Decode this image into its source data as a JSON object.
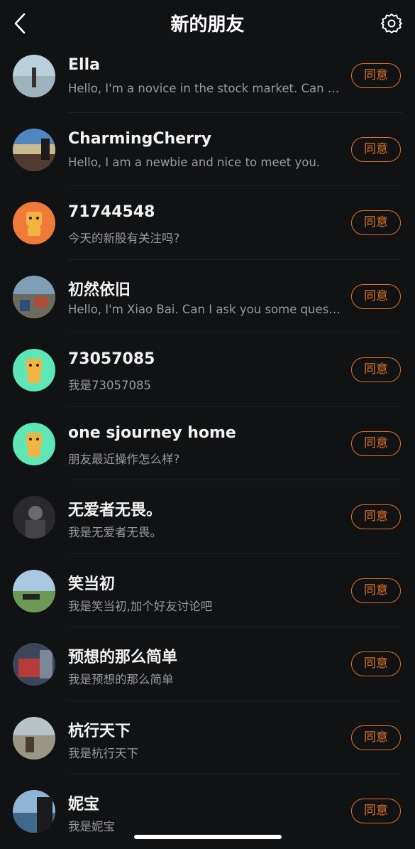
{
  "header": {
    "title": "新的朋友",
    "back_icon": "chevron-left-icon",
    "settings_icon": "gear-icon"
  },
  "colors": {
    "background": "#111214",
    "accent": "#e0742a",
    "secondary_text": "#9a9a9e"
  },
  "requests": [
    {
      "name": "Ella",
      "message": "Hello, I'm a novice in the stock market. Can I ask you some questions?",
      "accept_label": "同意",
      "avatar": "beach-photo"
    },
    {
      "name": "CharmingCherry",
      "message": "Hello, I am a newbie and nice to meet you.",
      "accept_label": "同意",
      "avatar": "seaside-photo"
    },
    {
      "name": "71744548",
      "message": "今天的新股有关注吗?",
      "accept_label": "同意",
      "avatar": "mascot-orange"
    },
    {
      "name": "初然依旧",
      "message": "Hello, I'm Xiao Bai. Can I ask you some questions?",
      "accept_label": "同意",
      "avatar": "harbor-photo"
    },
    {
      "name": "73057085",
      "message": "我是73057085",
      "accept_label": "同意",
      "avatar": "mascot-green"
    },
    {
      "name": "one sjourney home",
      "message": "朋友最近操作怎么样?",
      "accept_label": "同意",
      "avatar": "mascot-green"
    },
    {
      "name": "无爱者无畏。",
      "message": "我是无爱者无畏。",
      "accept_label": "同意",
      "avatar": "dark-portrait"
    },
    {
      "name": "笑当初",
      "message": "我是笑当初,加个好友讨论吧",
      "accept_label": "同意",
      "avatar": "lawn-photo"
    },
    {
      "name": "预想的那么简单",
      "message": "我是预想的那么简单",
      "accept_label": "同意",
      "avatar": "interior-photo"
    },
    {
      "name": "杭行天下",
      "message": "我是杭行天下",
      "accept_label": "同意",
      "avatar": "beach-dog-photo"
    },
    {
      "name": "妮宝",
      "message": "我是妮宝",
      "accept_label": "同意",
      "avatar": "sea-portrait"
    }
  ]
}
